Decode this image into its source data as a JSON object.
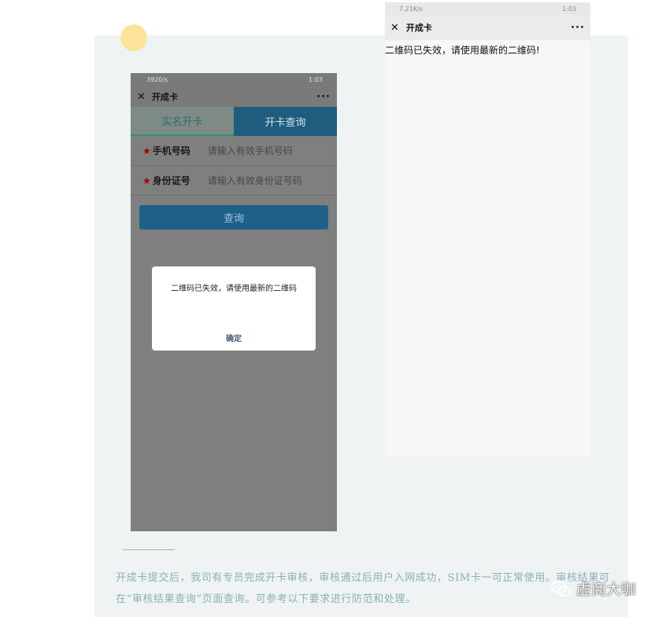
{
  "left_phone": {
    "status": {
      "left": "3920/s",
      "right": "1:03"
    },
    "title": "开成卡",
    "tabs": [
      "实名开卡",
      "开卡查询"
    ],
    "fields": [
      {
        "required": "★",
        "label": "手机号码",
        "placeholder": "请输入有效手机号码"
      },
      {
        "required": "★",
        "label": "身份证号",
        "placeholder": "请输入有效身份证号码"
      }
    ],
    "query_button": "查询",
    "dialog": {
      "message": "二维码已失效，请使用最新的二维码",
      "confirm": "确定"
    }
  },
  "right_phone": {
    "status": {
      "left": "7.21K/s",
      "right": "1:03"
    },
    "title": "开成卡",
    "message": "二维码已失效，请使用最新的二维码!"
  },
  "caption": "开成卡提交后，我司有专员完成开卡审核，审核通过后用户入网成功，SIM卡一可正常使用。审核结果可在“审核结果查询”页面查询。可参考以下要求进行防范和处理。",
  "watermark": "虚商大咖",
  "colors": {
    "panel": "#eff3f4",
    "accent_dot": "#fbe39c",
    "tab_active": "#1e5d7e",
    "button": "#1f6089",
    "caption": "#8ab0b4"
  }
}
